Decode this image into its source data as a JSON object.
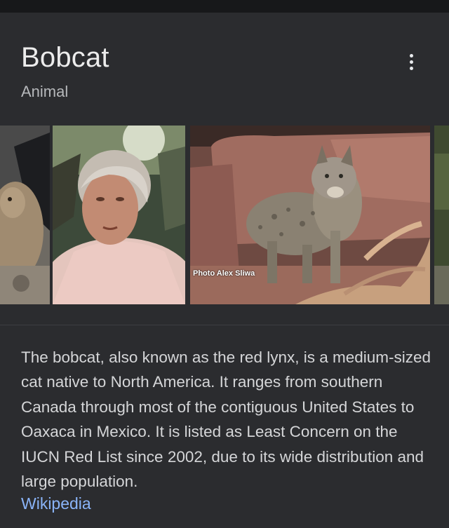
{
  "header": {
    "title": "Bobcat",
    "subtitle": "Animal",
    "menu_icon": "more-vertical-icon"
  },
  "gallery": {
    "images": [
      {
        "name": "bobcat-partial-image"
      },
      {
        "name": "elderly-woman-image"
      },
      {
        "name": "bobcat-on-rocks-image",
        "credit": "Photo Alex Sliwa"
      },
      {
        "name": "edge-partial-image"
      }
    ]
  },
  "description": {
    "text": "The bobcat, also known as the red lynx, is a medium-sized cat native to North America. It ranges from southern Canada through most of the contiguous United States to Oaxaca in Mexico. It is listed as Least Concern on the IUCN Red List since 2002, due to its wide distribution and large population.",
    "source_link": "Wikipedia"
  },
  "colors": {
    "background": "#2b2c2f",
    "link": "#8ab4f8",
    "title": "#ececec"
  }
}
